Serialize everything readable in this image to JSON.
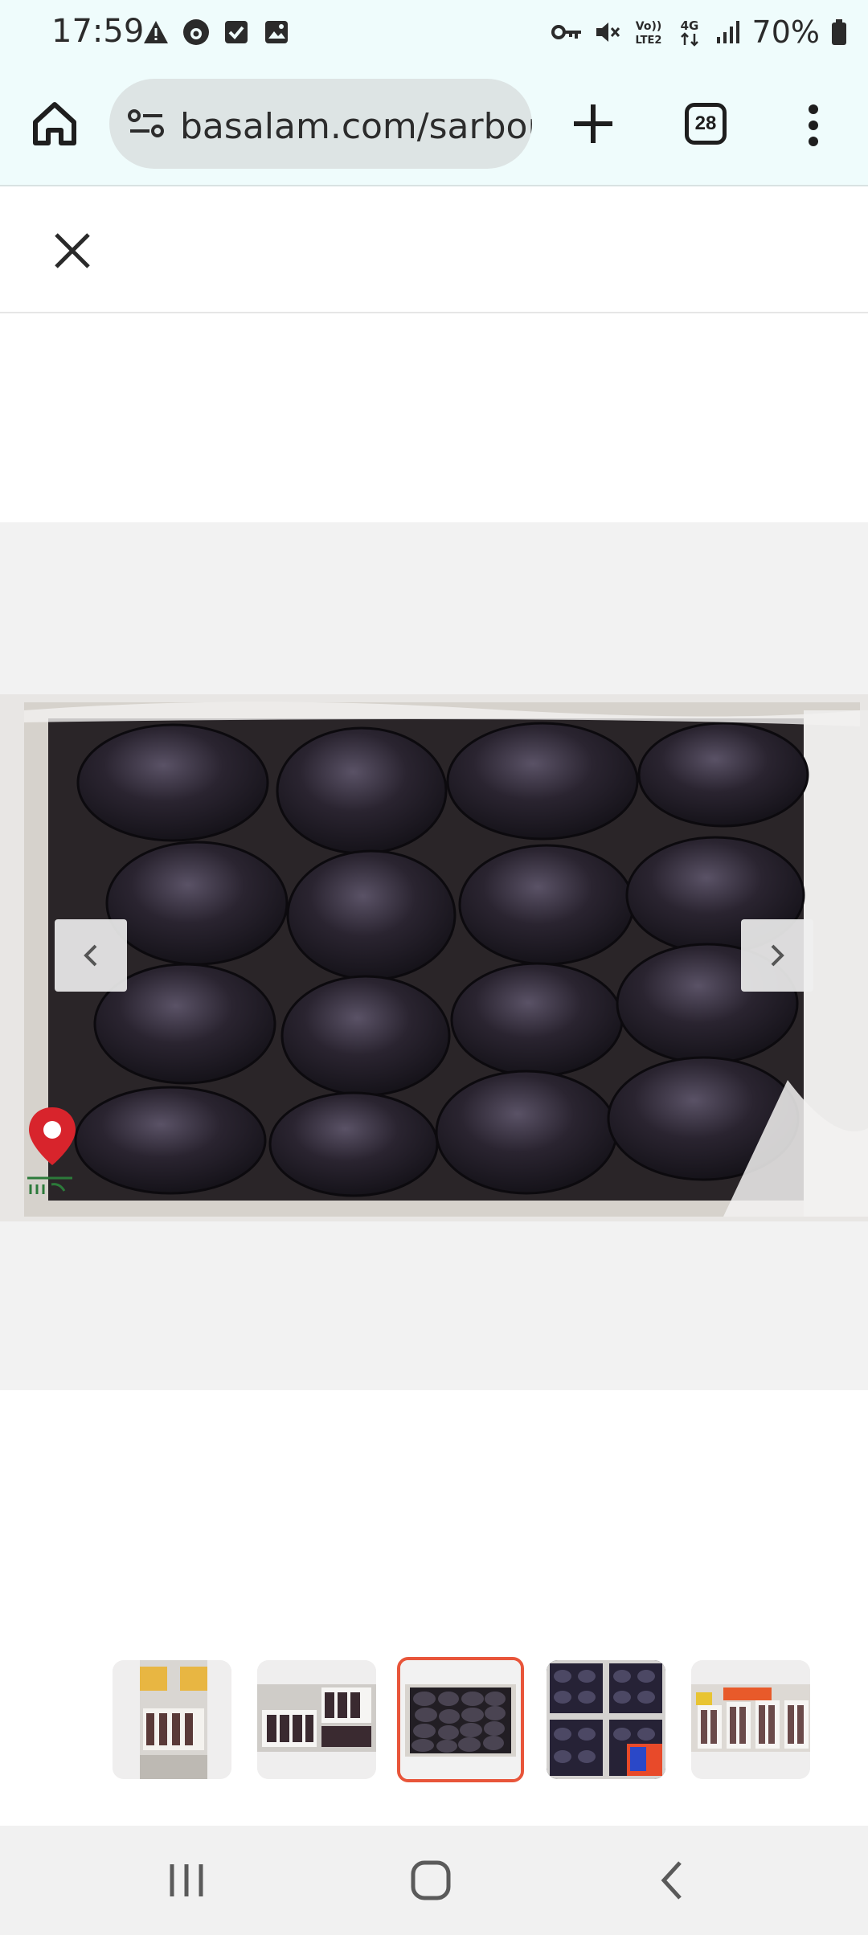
{
  "status_bar": {
    "time": "17:59",
    "battery": "70%",
    "left_icons": [
      "warning-icon",
      "notification-icon",
      "checkbox-icon",
      "gallery-icon"
    ],
    "right_icons": [
      "vpn-key-icon",
      "mute-icon",
      "volte-icon",
      "4g-icon",
      "signal-icon",
      "battery-icon"
    ]
  },
  "browser": {
    "url": "basalam.com/sarbor",
    "tab_count": "28"
  },
  "viewer": {
    "current_index": 3,
    "total_images": 5
  },
  "thumbnails": [
    {
      "name": "thumbnail-1",
      "active": false
    },
    {
      "name": "thumbnail-2",
      "active": false
    },
    {
      "name": "thumbnail-3",
      "active": true
    },
    {
      "name": "thumbnail-4",
      "active": false
    },
    {
      "name": "thumbnail-5",
      "active": false
    }
  ],
  "colors": {
    "browser_bg": "#effcfc",
    "active_thumb_border": "#e8553a",
    "viewer_bg": "#f2f2f2"
  }
}
